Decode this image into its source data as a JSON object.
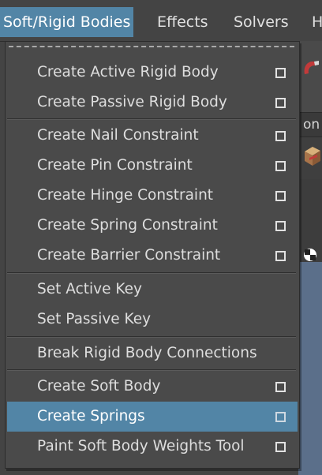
{
  "menubar": {
    "items": [
      {
        "label": "Soft/Rigid Bodies",
        "active": true
      },
      {
        "label": "Effects"
      },
      {
        "label": "Solvers"
      },
      {
        "label": "H"
      }
    ]
  },
  "background": {
    "field_text": "on",
    "icons": [
      "magnet-icon",
      "box-icon",
      "checker-icon"
    ]
  },
  "dropdown": {
    "items": [
      {
        "label": "Create Active Rigid Body",
        "option_box": true
      },
      {
        "label": "Create Passive Rigid Body",
        "option_box": true
      },
      {
        "label": "Create Nail Constraint",
        "option_box": true
      },
      {
        "label": "Create Pin Constraint",
        "option_box": true
      },
      {
        "label": "Create Hinge Constraint",
        "option_box": true
      },
      {
        "label": "Create Spring Constraint",
        "option_box": true
      },
      {
        "label": "Create Barrier Constraint",
        "option_box": true
      },
      {
        "label": "Set Active Key",
        "option_box": false
      },
      {
        "label": "Set Passive Key",
        "option_box": false
      },
      {
        "label": "Break Rigid Body Connections",
        "option_box": false
      },
      {
        "label": "Create Soft Body",
        "option_box": true
      },
      {
        "label": "Create Springs",
        "option_box": true,
        "highlighted": true
      },
      {
        "label": "Paint Soft Body Weights Tool",
        "option_box": true
      }
    ]
  },
  "colors": {
    "highlight": "#5285a6",
    "background": "#444444",
    "menu_background": "#4a4a4a",
    "text": "#dedede"
  }
}
